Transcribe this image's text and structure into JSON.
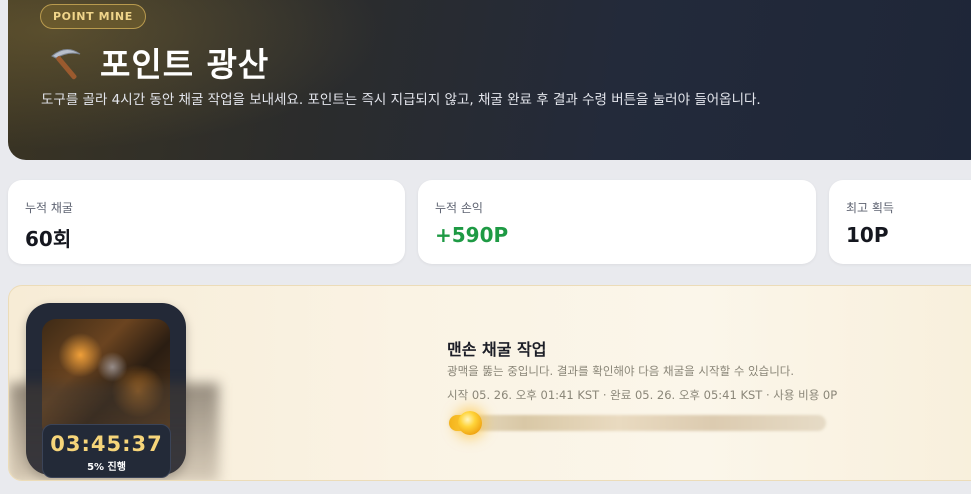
{
  "hero": {
    "badge": "POINT MINE",
    "icon": "pickaxe-icon",
    "title": "포인트 광산",
    "description": "도구를 골라 4시간 동안 채굴 작업을 보내세요. 포인트는 즉시 지급되지 않고, 채굴 완료 후 결과 수령 버튼을 눌러야 들어옵니다."
  },
  "stats": [
    {
      "label": "누적 채굴",
      "value": "60회"
    },
    {
      "label": "누적 손익",
      "value": "+590P"
    },
    {
      "label": "최고 획득",
      "value": "10P"
    }
  ],
  "job": {
    "timer": "03:45:37",
    "progress_text": "5% 진행",
    "progress": 0.05,
    "title": "맨손 채굴 작업",
    "subtitle": "광맥을 뚫는 중입니다. 결과를 확인해야 다음 채굴을 시작할 수 있습니다.",
    "meta": "시작 05. 26. 오후 01:41 KST · 완료 05. 26. 오후 05:41 KST · 사용 비용 0P"
  },
  "colors": {
    "accent_gold": "#f6d57a",
    "positive": "#1e9a44"
  }
}
